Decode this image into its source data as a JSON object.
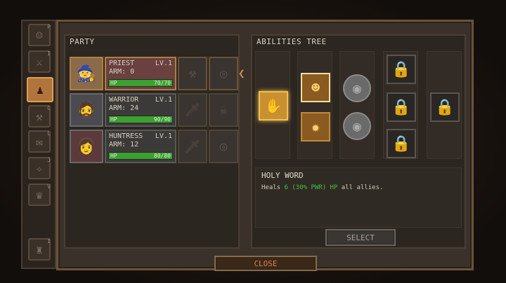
{
  "party": {
    "title": "PARTY",
    "members": [
      {
        "name": "PRIEST",
        "level": "LV.1",
        "armor": "ARM: 0",
        "hp_label": "HP",
        "hp": "70/70",
        "hp_fraction": 1.0,
        "icon": "priest-portrait"
      },
      {
        "name": "WARRIOR",
        "level": "LV.1",
        "armor": "ARM: 24",
        "hp_label": "HP",
        "hp": "90/90",
        "hp_fraction": 1.0,
        "icon": "warrior-portrait"
      },
      {
        "name": "HUNTRESS",
        "level": "LV.1",
        "armor": "ARM: 12",
        "hp_label": "HP",
        "hp": "80/80",
        "hp_fraction": 1.0,
        "icon": "huntress-portrait"
      }
    ]
  },
  "abilities": {
    "title": "ABILITIES TREE",
    "selected": {
      "name": "HOLY WORD",
      "desc_prefix": "Heals",
      "desc_value": "6 (30% PWR) HP",
      "desc_suffix": "all allies."
    },
    "select_label": "SELECT"
  },
  "close_label": "CLOSE",
  "help_label": "?",
  "tabs": [
    "P",
    "I",
    "",
    "C",
    "L",
    "J",
    "V",
    "I"
  ],
  "colors": {
    "hp": "#3aa030",
    "accent": "#f0c050",
    "close_text": "#e08050"
  }
}
